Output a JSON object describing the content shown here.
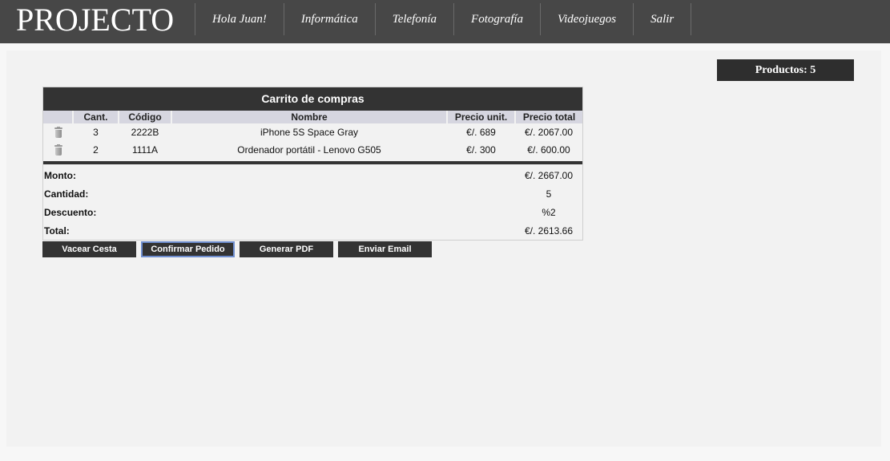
{
  "header": {
    "logo": "PROJECTO",
    "nav": [
      "Hola Juan!",
      "Informática",
      "Telefonía",
      "Fotografía",
      "Videojuegos",
      "Salir"
    ]
  },
  "counter": {
    "label": "Productos: 5"
  },
  "cart": {
    "title": "Carrito de compras",
    "columns": [
      "",
      "Cant.",
      "Código",
      "Nombre",
      "Precio unit.",
      "Precio total"
    ],
    "rows": [
      {
        "qty": "3",
        "code": "2222B",
        "name": "iPhone 5S Space Gray",
        "unit": "€/. 689",
        "total": "€/. 2067.00",
        "icon": "trash-icon"
      },
      {
        "qty": "2",
        "code": "1111A",
        "name": "Ordenador portátil - Lenovo G505",
        "unit": "€/. 300",
        "total": "€/. 600.00",
        "icon": "trash-icon"
      }
    ],
    "summary": {
      "monto_label": "Monto:",
      "monto_value": "€/. 2667.00",
      "cantidad_label": "Cantidad:",
      "cantidad_value": "5",
      "descuento_label": "Descuento:",
      "descuento_value": "%2",
      "total_label": "Total:",
      "total_value": "€/. 2613.66"
    }
  },
  "actions": {
    "empty": "Vacear Cesta",
    "confirm": "Confirmar Pedido",
    "pdf": "Generar PDF",
    "email": "Enviar Email"
  },
  "colors": {
    "header_bg": "#474747",
    "dark": "#333333",
    "table_header": "#d6d6e0",
    "focus_border": "#6f8ecf"
  }
}
